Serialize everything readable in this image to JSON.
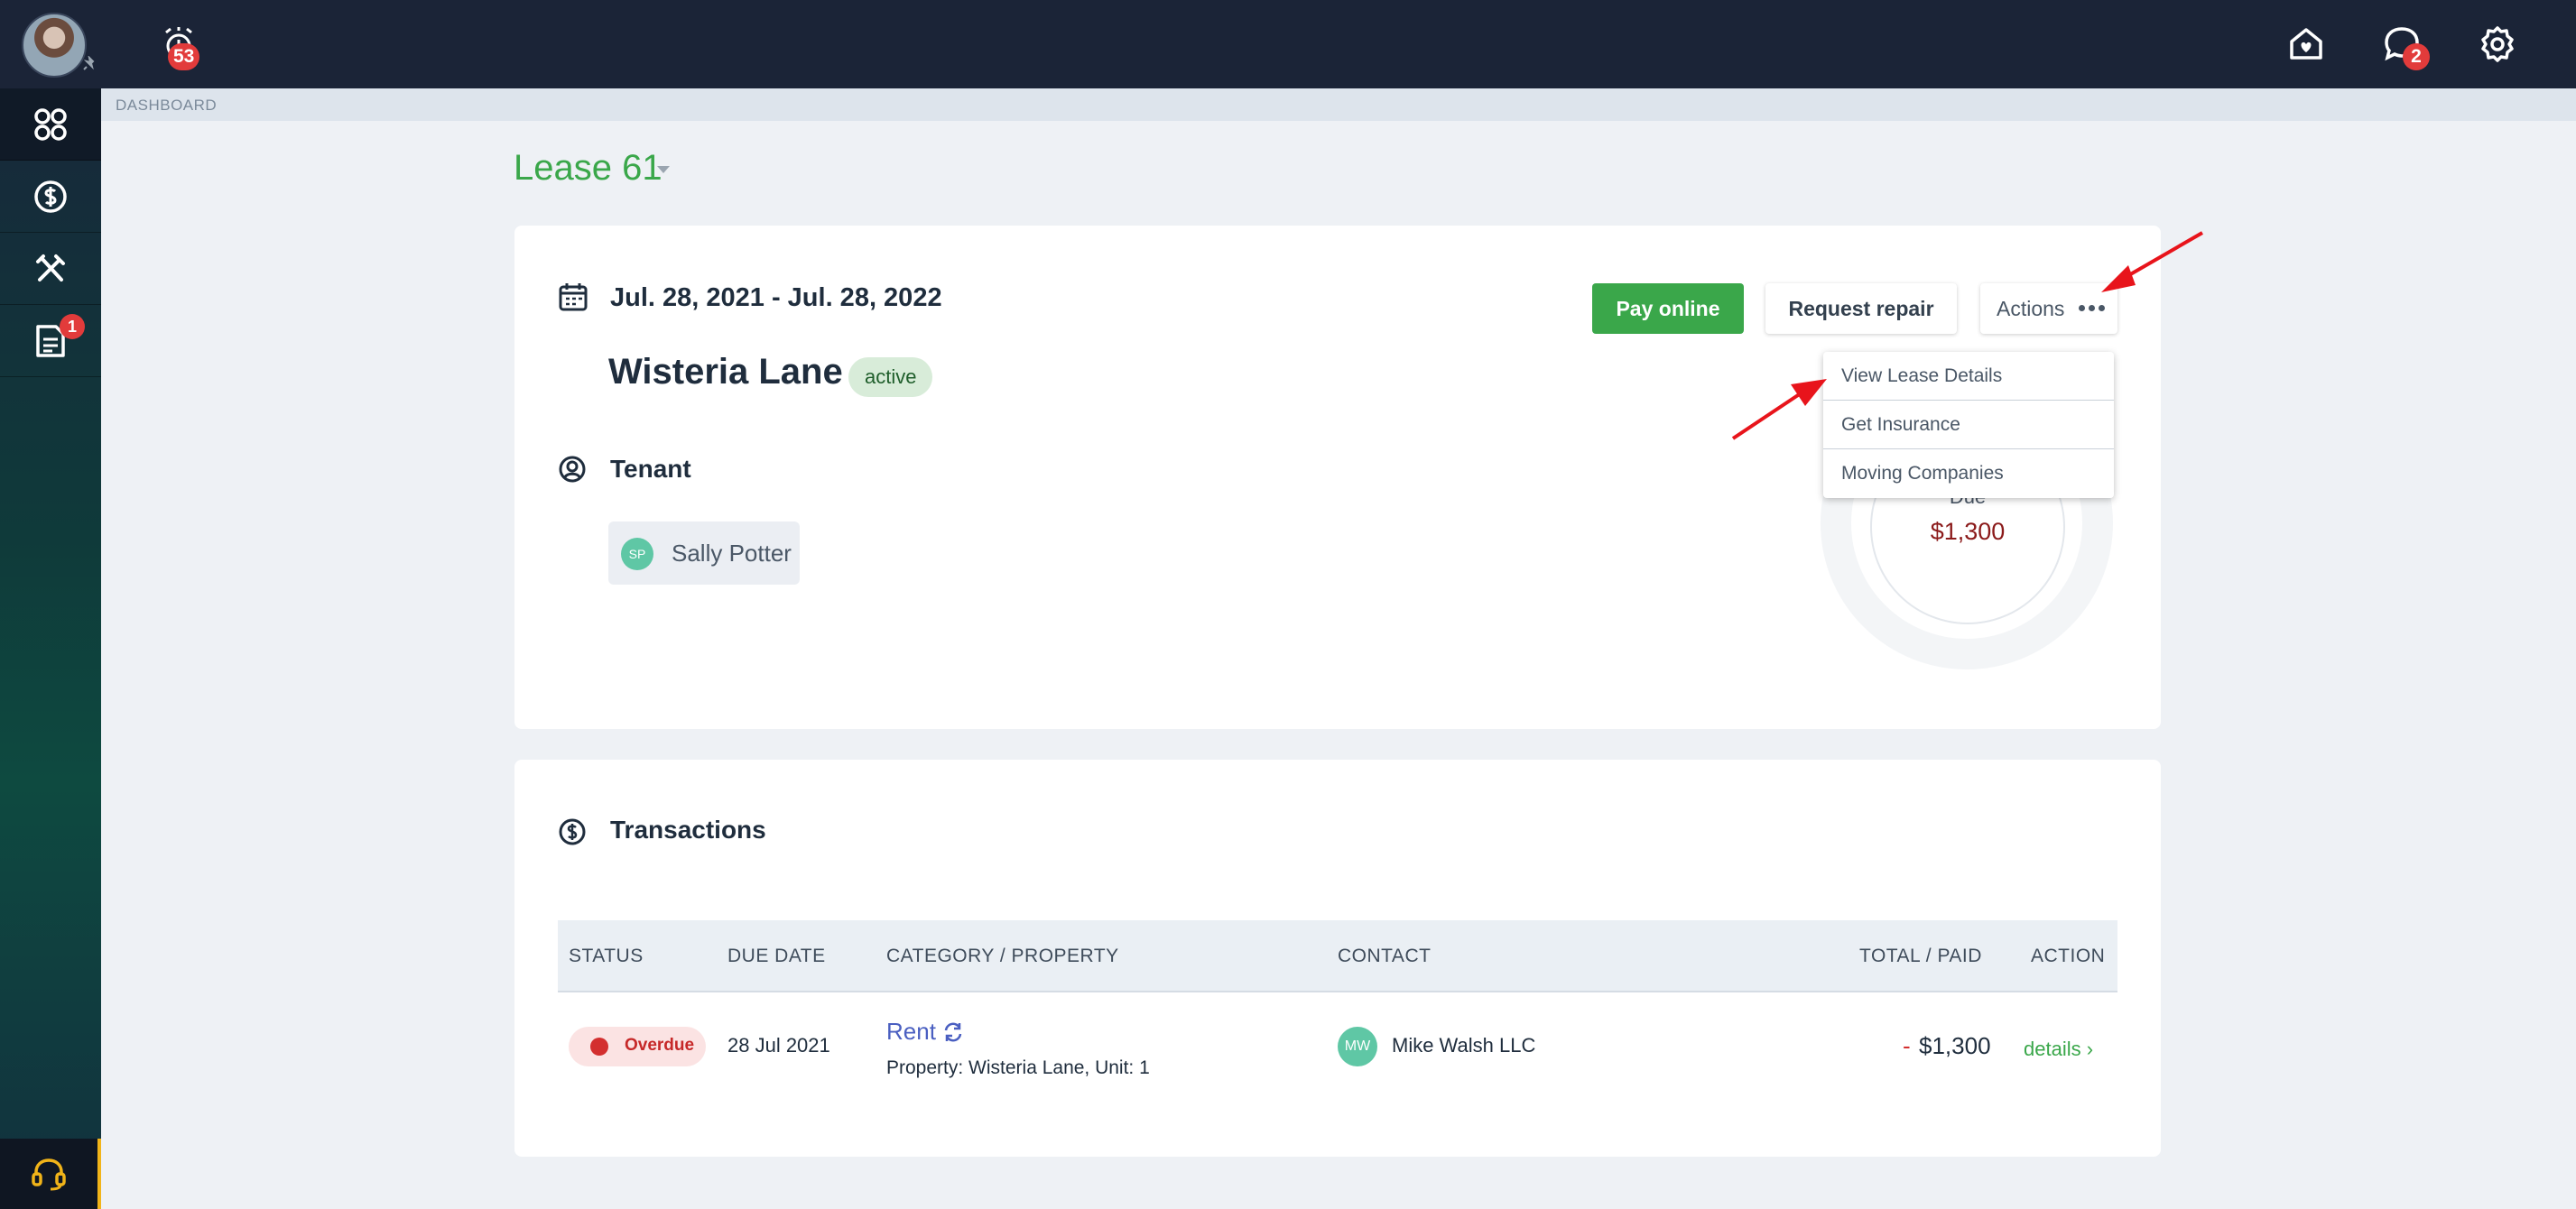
{
  "topbar": {
    "alarm_count": "53",
    "message_count": "2"
  },
  "sidebar": {
    "items": [
      {
        "icon": "dashboard-icon"
      },
      {
        "icon": "dollar-icon"
      },
      {
        "icon": "tools-icon"
      },
      {
        "icon": "document-icon",
        "badge": "1"
      }
    ]
  },
  "breadcrumb": "DASHBOARD",
  "lease": {
    "title": "Lease 61",
    "date_range": "Jul. 28, 2021 - Jul. 28, 2022",
    "property": "Wisteria Lane",
    "status": "active",
    "tenant_label": "Tenant",
    "tenant": {
      "initials": "SP",
      "name": "Sally Potter"
    }
  },
  "buttons": {
    "pay": "Pay online",
    "repair": "Request repair",
    "actions": "Actions"
  },
  "actions_menu": [
    "View Lease Details",
    "Get Insurance",
    "Moving Companies"
  ],
  "due": {
    "label": "Due",
    "amount": "$1,300"
  },
  "transactions": {
    "title": "Transactions",
    "headers": [
      "STATUS",
      "DUE DATE",
      "CATEGORY / PROPERTY",
      "CONTACT",
      "TOTAL / PAID",
      "ACTION"
    ],
    "rows": [
      {
        "status": "Overdue",
        "due_date": "28 Jul 2021",
        "category": "Rent",
        "property": "Property: Wisteria Lane, Unit: 1",
        "contact_initials": "MW",
        "contact": "Mike Walsh LLC",
        "total_sign": "-",
        "total": "$1,300",
        "action": "details ›"
      }
    ]
  },
  "colors": {
    "accent_green": "#3aa74a",
    "topbar": "#1b2437",
    "overdue": "#d32f2f"
  }
}
